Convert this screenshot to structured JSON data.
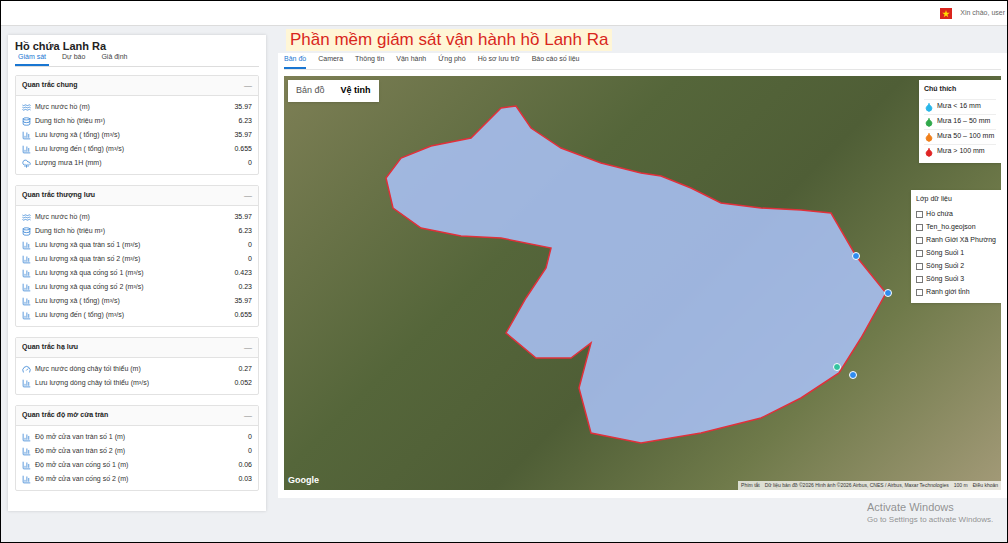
{
  "top_bar": {
    "greeting": "Xin chào, user"
  },
  "sidebar": {
    "title": "Hồ chứa Lanh Ra",
    "tabs": [
      {
        "label": "Giám sát",
        "selected": true
      },
      {
        "label": "Dự báo",
        "selected": false
      },
      {
        "label": "Giả định",
        "selected": false
      }
    ],
    "sections": [
      {
        "title": "Quan trắc chung",
        "toggle": "—",
        "rows": [
          {
            "label": "Mực nước hồ (m)",
            "value": "35.97"
          },
          {
            "label": "Dung tích hồ (triệu m³)",
            "value": "6.23"
          },
          {
            "label": "Lưu lượng xả ( tổng) (m³/s)",
            "value": "35.97"
          },
          {
            "label": "Lưu lượng đến ( tổng) (m³/s)",
            "value": "0.655"
          },
          {
            "label": "Lượng mưa 1H (mm)",
            "value": "0"
          }
        ]
      },
      {
        "title": "Quan trắc thượng lưu",
        "toggle": "—",
        "rows": [
          {
            "label": "Mực nước hồ (m)",
            "value": "35.97"
          },
          {
            "label": "Dung tích hồ (triệu m³)",
            "value": "6.23"
          },
          {
            "label": "Lưu lượng xả qua tràn số 1 (m³/s)",
            "value": "0"
          },
          {
            "label": "Lưu lượng xả qua tràn số 2 (m³/s)",
            "value": "0"
          },
          {
            "label": "Lưu lượng xả qua cống số 1 (m³/s)",
            "value": "0.423"
          },
          {
            "label": "Lưu lượng xả qua cống số 2 (m³/s)",
            "value": "0.23"
          },
          {
            "label": "Lưu lượng xả ( tổng) (m³/s)",
            "value": "35.97"
          },
          {
            "label": "Lưu lượng đến ( tổng) (m³/s)",
            "value": "0.655"
          }
        ]
      },
      {
        "title": "Quan trắc hạ lưu",
        "toggle": "—",
        "rows": [
          {
            "label": "Mực nước dòng chảy tối thiểu (m)",
            "value": "0.27"
          },
          {
            "label": "Lưu lượng dòng chảy tối thiểu (m³/s)",
            "value": "0.052"
          }
        ]
      },
      {
        "title": "Quan trắc độ mở cửa tràn",
        "toggle": "—",
        "rows": [
          {
            "label": "Độ mở cửa van tràn số 1 (m)",
            "value": "0"
          },
          {
            "label": "Độ mở cửa van tràn số 2 (m)",
            "value": "0"
          },
          {
            "label": "Độ mở cửa van cống số 1 (m)",
            "value": "0.06"
          },
          {
            "label": "Độ mở cửa van cống số 2 (m)",
            "value": "0.03"
          }
        ]
      }
    ]
  },
  "main": {
    "title": "Phần mềm giám sát vận hành hồ Lanh Ra",
    "tabs": [
      {
        "label": "Bản đồ",
        "selected": true
      },
      {
        "label": "Camera",
        "selected": false
      },
      {
        "label": "Thông tin",
        "selected": false
      },
      {
        "label": "Vận hành",
        "selected": false
      },
      {
        "label": "Ứng phó",
        "selected": false
      },
      {
        "label": "Hồ sơ lưu trữ",
        "selected": false
      },
      {
        "label": "Báo cáo số liệu",
        "selected": false
      }
    ],
    "map": {
      "map_types": [
        {
          "label": "Bản đồ",
          "selected": false
        },
        {
          "label": "Vệ tinh",
          "selected": true
        }
      ],
      "legend": {
        "title": "Chú thích",
        "items": [
          {
            "label": "Mưa < 16 mm",
            "color": "#29b6e8"
          },
          {
            "label": "Mưa 16 – 50 mm",
            "color": "#2fa84a"
          },
          {
            "label": "Mưa 50 – 100 mm",
            "color": "#f07f1a"
          },
          {
            "label": "Mưa > 100 mm",
            "color": "#e02424"
          }
        ]
      },
      "layers": {
        "title": "Lớp dữ liệu",
        "items": [
          {
            "label": "Hồ chứa",
            "checked": false
          },
          {
            "label": "Ten_ho.geojson",
            "checked": false
          },
          {
            "label": "Ranh Giới Xã Phường",
            "checked": false
          },
          {
            "label": "Sông Suối 1",
            "checked": false
          },
          {
            "label": "Sông Suối 2",
            "checked": false
          },
          {
            "label": "Sông Suối 3",
            "checked": false
          },
          {
            "label": "Ranh giới tỉnh",
            "checked": false
          }
        ]
      },
      "pins": [
        {
          "color": "#2f8cf0"
        },
        {
          "color": "#2f8cf0"
        },
        {
          "color": "#34c3a0"
        },
        {
          "color": "#2f8cf0"
        }
      ],
      "logo": "Google",
      "attribution": [
        "Phím tắt",
        "Dữ liệu bản đồ ©2026 Hình ảnh ©2026 Airbus, CNES / Airbus, Maxar Technologies",
        "100 m",
        "Điều khoản"
      ]
    }
  },
  "watermark": {
    "title": "Activate Windows",
    "subtitle": "Go to Settings to activate Windows."
  }
}
